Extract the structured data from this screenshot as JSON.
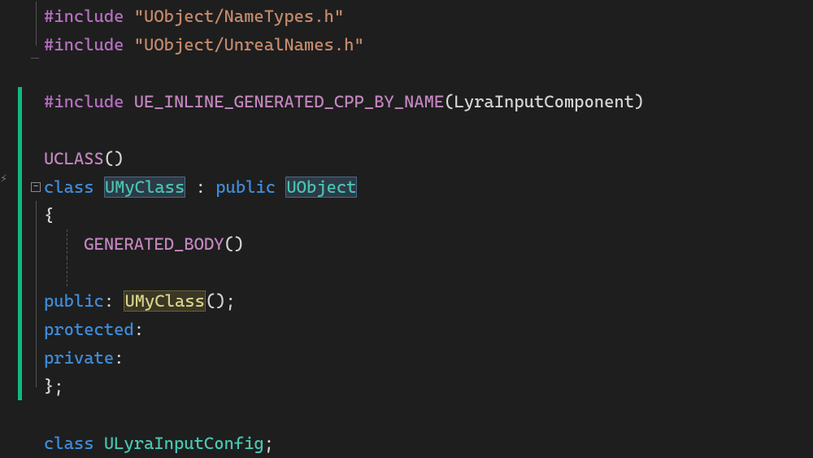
{
  "code": {
    "l1": {
      "include": "#include",
      "path": "\"UObject/NameTypes.h\""
    },
    "l2": {
      "include": "#include",
      "path": "\"UObject/UnrealNames.h\""
    },
    "l3": {
      "include": "#include",
      "macro": "UE_INLINE_GENERATED_CPP_BY_NAME",
      "arg": "LyraInputComponent"
    },
    "l4": {
      "uclass": "UCLASS"
    },
    "l5": {
      "kw_class": "class",
      "name": "UMyClass",
      "colon": " : ",
      "kw_public": "public",
      "base": "UObject"
    },
    "l6": {
      "brace": "{"
    },
    "l7": {
      "macro": "GENERATED_BODY"
    },
    "l8": {
      "kw": "public",
      "name": "UMyClass"
    },
    "l9": {
      "kw": "protected"
    },
    "l10": {
      "kw": "private"
    },
    "l11": {
      "brace": "};"
    },
    "l12": {
      "kw_class": "class",
      "name": "ULyraInputConfig"
    }
  }
}
